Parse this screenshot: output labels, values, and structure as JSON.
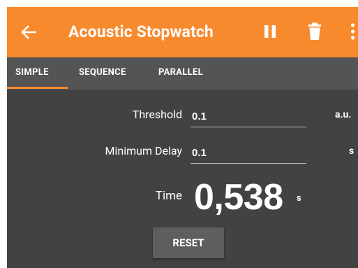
{
  "appbar": {
    "title": "Acoustic Stopwatch",
    "back_icon": "arrow-back-icon",
    "pause_icon": "pause-icon",
    "delete_icon": "trash-icon",
    "more_icon": "more-vert-icon"
  },
  "tabs": [
    {
      "label": "SIMPLE",
      "selected": true
    },
    {
      "label": "SEQUENCE",
      "selected": false
    },
    {
      "label": "PARALLEL",
      "selected": false
    }
  ],
  "form": {
    "threshold": {
      "label": "Threshold",
      "value": "0.1",
      "unit": "a.u."
    },
    "min_delay": {
      "label": "Minimum Delay",
      "value": "0.1",
      "unit": "s"
    }
  },
  "time": {
    "label": "Time",
    "value": "0,538",
    "unit": "s"
  },
  "reset_label": "RESET",
  "colors": {
    "accent": "#f88a2e",
    "background": "#424242",
    "tabbar": "#545454",
    "button": "#5e5e5e"
  }
}
